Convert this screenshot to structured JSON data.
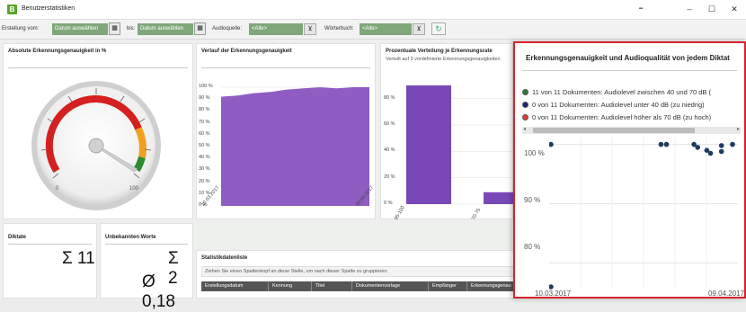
{
  "window": {
    "title": "Benutzerstatistiken",
    "minimize": "–",
    "maximize": "☐",
    "close": "✕",
    "extra": "▪▪"
  },
  "filter": {
    "from_label": "Erstellung vom:",
    "from_value": "Datum auswählen",
    "to_label": "bis:",
    "to_value": "Datum auswählen",
    "audio_label": "Audioquelle:",
    "audio_value": "<Alle>",
    "dict_label": "Wörterbuch:",
    "dict_value": "<Alle>"
  },
  "gauge": {
    "title": "Absolute Erkennungsgenauigkeit in %",
    "min_label": "0",
    "max_label": "100",
    "value": 99
  },
  "verlauf": {
    "title": "Verlauf der Erkennungsgenauigkeit",
    "yticks": [
      "100 %",
      "90 %",
      "80 %",
      "70 %",
      "60 %",
      "50 %",
      "40 %",
      "30 %",
      "20 %",
      "10 %",
      "0 %"
    ],
    "xticks": [
      "10.03.2017",
      "09.04.2017"
    ]
  },
  "verteilung": {
    "title": "Prozentuale Verteilung je Erkennungsrate",
    "subtitle": "Verteilt auf 3 vordefinierte Erkennungsgenauigkeiten",
    "yticks": [
      "80 %",
      "60 %",
      "40 %",
      "20 %",
      "0 %"
    ],
    "xticks": [
      "95-100",
      "70-75"
    ]
  },
  "diktate": {
    "label": "Diktate",
    "value": "Σ 11"
  },
  "unbekannt": {
    "label": "Unbekannten Worte",
    "sum": "Σ 2",
    "avg": "Ø 0,18"
  },
  "tabelle": {
    "title": "Statistikdatenliste",
    "group_hint": "Ziehen Sie einen Spaltenkopf an diese Stelle, um nach dieser Spalte zu gruppieren.",
    "columns": [
      "Erstellungsdatum",
      "Kennung",
      "Titel",
      "Dokumentenvorlage",
      "Empfänger",
      "Erkennungsgenau"
    ]
  },
  "popup": {
    "title": "Erkennungsgenauigkeit und Audioqualität von jedem Diktat",
    "legend": [
      {
        "text": "11 von 11 Dokumenten: Audiolevel zwischen 40 und 70 dB (",
        "color": "#2e7d32"
      },
      {
        "text": "0 von 11 Dokumenten: Audiolevel unter 40 dB (zu niedrig)",
        "color": "#1a237e"
      },
      {
        "text": "0 von 11 Dokumenten: Audiolevel höher als 70 dB (zu hoch)",
        "color": "#e53935"
      }
    ],
    "yticks": [
      "100 %",
      "90 %",
      "80 %"
    ],
    "xticks": [
      "10.03.2017",
      "09.04.2017"
    ]
  },
  "chart_data": [
    {
      "type": "area",
      "title": "Verlauf der Erkennungsgenauigkeit",
      "x": [
        "10.03.2017",
        "09.04.2017"
      ],
      "series": [
        {
          "values": [
            92,
            93,
            95,
            96,
            98,
            99,
            100,
            99,
            100,
            100
          ]
        }
      ],
      "ylim": [
        0,
        100
      ],
      "color": "#8e5cc2"
    },
    {
      "type": "bar",
      "title": "Prozentuale Verteilung je Erkennungsrate",
      "categories": [
        "95-100",
        "70-75"
      ],
      "values": [
        91,
        9
      ],
      "ylim": [
        0,
        90
      ],
      "color": "#7a47b8"
    },
    {
      "type": "scatter",
      "title": "Erkennungsgenauigkeit und Audioqualität von jedem Diktat",
      "ylim": [
        76,
        101
      ],
      "points": [
        {
          "x": 0.0,
          "y": 100
        },
        {
          "x": 0.0,
          "y": 76
        },
        {
          "x": 0.6,
          "y": 100
        },
        {
          "x": 0.63,
          "y": 100
        },
        {
          "x": 0.78,
          "y": 100
        },
        {
          "x": 0.8,
          "y": 99.5
        },
        {
          "x": 0.85,
          "y": 99
        },
        {
          "x": 0.87,
          "y": 98.5
        },
        {
          "x": 0.93,
          "y": 99.8
        },
        {
          "x": 0.93,
          "y": 98.8
        },
        {
          "x": 0.99,
          "y": 100
        }
      ],
      "color": "#1e3a5f"
    }
  ]
}
